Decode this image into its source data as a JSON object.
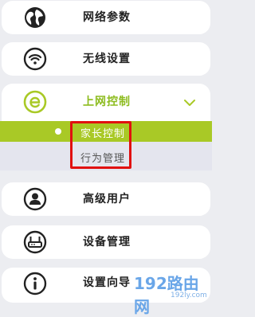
{
  "menu": {
    "network_params": "网络参数",
    "wireless_settings": "无线设置",
    "internet_control": "上网控制",
    "advanced_users": "高级用户",
    "device_management": "设备管理",
    "setup_wizard": "设置向导"
  },
  "submenu": {
    "parental_control": "家长控制",
    "behavior_management": "行为管理"
  },
  "watermark": {
    "main": "192路由网",
    "sub": "192ly.com"
  },
  "colors": {
    "accent": "#a9c926",
    "accent_text": "#8dbc1f",
    "highlight": "#e11010"
  }
}
